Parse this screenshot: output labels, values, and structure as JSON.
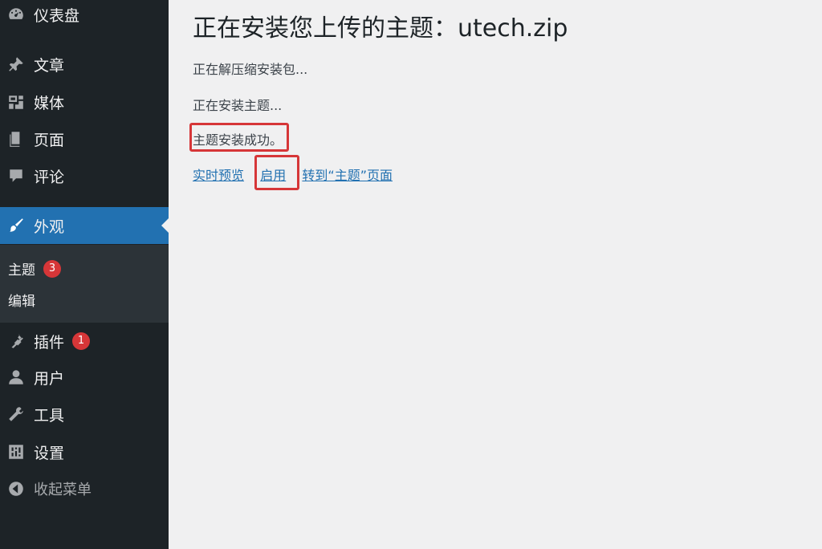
{
  "sidebar": {
    "items": [
      {
        "label": "仪表盘",
        "icon": "dashboard-icon"
      },
      {
        "label": "文章",
        "icon": "pushpin-icon"
      },
      {
        "label": "媒体",
        "icon": "media-icon"
      },
      {
        "label": "页面",
        "icon": "pages-icon"
      },
      {
        "label": "评论",
        "icon": "comment-icon"
      },
      {
        "label": "外观",
        "icon": "paintbrush-icon"
      },
      {
        "label": "插件",
        "icon": "plugin-icon",
        "badge": "1"
      },
      {
        "label": "用户",
        "icon": "user-icon"
      },
      {
        "label": "工具",
        "icon": "wrench-icon"
      },
      {
        "label": "设置",
        "icon": "settings-icon"
      },
      {
        "label": "收起菜单",
        "icon": "collapse-icon"
      }
    ],
    "submenu": [
      {
        "label": "主题",
        "badge": "3"
      },
      {
        "label": "编辑"
      }
    ],
    "active_color": "#2271b1"
  },
  "main": {
    "title": "正在安装您上传的主题：utech.zip",
    "lines": [
      "正在解压缩安装包...",
      "正在安装主题...",
      "主题安装成功。"
    ],
    "actions": {
      "live_preview": "实时预览",
      "activate": "启用",
      "goto_themes": "转到“主题”页面"
    },
    "highlight_color": "#d63638"
  }
}
